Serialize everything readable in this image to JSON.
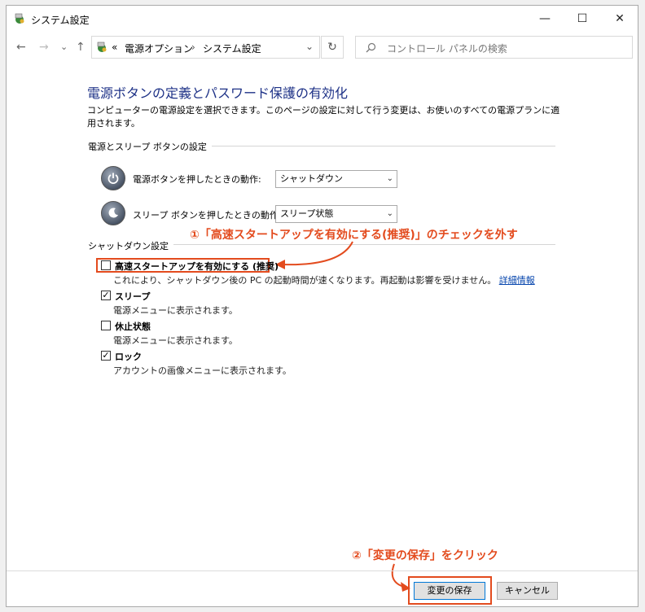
{
  "window": {
    "title": "システム設定"
  },
  "titlebar": {
    "minimize": "—",
    "maximize": "☐",
    "close": "✕"
  },
  "nav": {
    "back": "←",
    "forward": "→",
    "dropdown": "⌄",
    "up": "↑",
    "refresh": "↻"
  },
  "address": {
    "prefix": "«",
    "crumb1": "電源オプション",
    "sep": "›",
    "crumb2": "システム設定",
    "chevron": "⌄"
  },
  "search": {
    "placeholder": "コントロール パネルの検索"
  },
  "main": {
    "heading": "電源ボタンの定義とパスワード保護の有効化",
    "description": "コンピューターの電源設定を選択できます。このページの設定に対して行う変更は、お使いのすべての電源プランに適用されます。"
  },
  "power_group": {
    "title": "電源とスリープ ボタンの設定",
    "power_button": {
      "label": "電源ボタンを押したときの動作:",
      "value": "シャットダウン"
    },
    "sleep_button": {
      "label": "スリープ ボタンを押したときの動作:",
      "value": "スリープ状態"
    }
  },
  "shutdown_group": {
    "title": "シャットダウン設定",
    "fast_startup": {
      "label": "高速スタートアップを有効にする (推奨)",
      "checked": false,
      "description": "これにより、シャットダウン後の PC の起動時間が速くなります。再起動は影響を受けません。",
      "link": "詳細情報"
    },
    "sleep": {
      "label": "スリープ",
      "checked": true,
      "description": "電源メニューに表示されます。",
      "mark": "✓"
    },
    "hibernate": {
      "label": "休止状態",
      "checked": false,
      "description": "電源メニューに表示されます。"
    },
    "lock": {
      "label": "ロック",
      "checked": true,
      "description": "アカウントの画像メニューに表示されます。",
      "mark": "✓"
    }
  },
  "annotations": {
    "step1": "①「高速スタートアップを有効にする(推奨)」のチェックを外す",
    "step2": "②「変更の保存」をクリック"
  },
  "footer": {
    "save": "変更の保存",
    "cancel": "キャンセル"
  },
  "colors": {
    "accent": "#e34b1e",
    "heading": "#1e3287",
    "link": "#0645ad"
  }
}
